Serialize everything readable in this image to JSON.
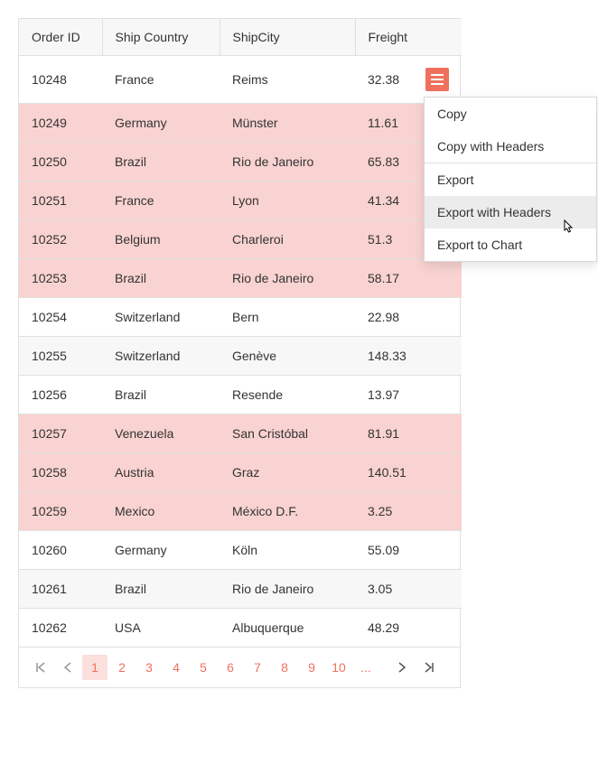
{
  "columns": [
    "Order ID",
    "Ship Country",
    "ShipCity",
    "Freight"
  ],
  "rows": [
    {
      "id": "10248",
      "country": "France",
      "city": "Reims",
      "freight": "32.38",
      "hl": false,
      "alt": false,
      "menu": true
    },
    {
      "id": "10249",
      "country": "Germany",
      "city": "Münster",
      "freight": "11.61",
      "hl": true,
      "alt": false
    },
    {
      "id": "10250",
      "country": "Brazil",
      "city": "Rio de Janeiro",
      "freight": "65.83",
      "hl": true,
      "alt": false
    },
    {
      "id": "10251",
      "country": "France",
      "city": "Lyon",
      "freight": "41.34",
      "hl": true,
      "alt": false
    },
    {
      "id": "10252",
      "country": "Belgium",
      "city": "Charleroi",
      "freight": "51.3",
      "hl": true,
      "alt": false
    },
    {
      "id": "10253",
      "country": "Brazil",
      "city": "Rio de Janeiro",
      "freight": "58.17",
      "hl": true,
      "alt": false
    },
    {
      "id": "10254",
      "country": "Switzerland",
      "city": "Bern",
      "freight": "22.98",
      "hl": false,
      "alt": false
    },
    {
      "id": "10255",
      "country": "Switzerland",
      "city": "Genève",
      "freight": "148.33",
      "hl": false,
      "alt": true
    },
    {
      "id": "10256",
      "country": "Brazil",
      "city": "Resende",
      "freight": "13.97",
      "hl": false,
      "alt": false
    },
    {
      "id": "10257",
      "country": "Venezuela",
      "city": "San Cristóbal",
      "freight": "81.91",
      "hl": true,
      "alt": false
    },
    {
      "id": "10258",
      "country": "Austria",
      "city": "Graz",
      "freight": "140.51",
      "hl": true,
      "alt": false
    },
    {
      "id": "10259",
      "country": "Mexico",
      "city": "México D.F.",
      "freight": "3.25",
      "hl": true,
      "alt": false
    },
    {
      "id": "10260",
      "country": "Germany",
      "city": "Köln",
      "freight": "55.09",
      "hl": false,
      "alt": false
    },
    {
      "id": "10261",
      "country": "Brazil",
      "city": "Rio de Janeiro",
      "freight": "3.05",
      "hl": false,
      "alt": true
    },
    {
      "id": "10262",
      "country": "USA",
      "city": "Albuquerque",
      "freight": "48.29",
      "hl": false,
      "alt": false
    }
  ],
  "context_menu": {
    "items": [
      {
        "label": "Copy"
      },
      {
        "label": "Copy with Headers"
      },
      {
        "sep": true
      },
      {
        "label": "Export"
      },
      {
        "label": "Export with Headers",
        "hover": true
      },
      {
        "label": "Export to Chart"
      }
    ]
  },
  "pager": {
    "pages": [
      "1",
      "2",
      "3",
      "4",
      "5",
      "6",
      "7",
      "8",
      "9",
      "10"
    ],
    "current": "1",
    "ellipsis": "..."
  }
}
